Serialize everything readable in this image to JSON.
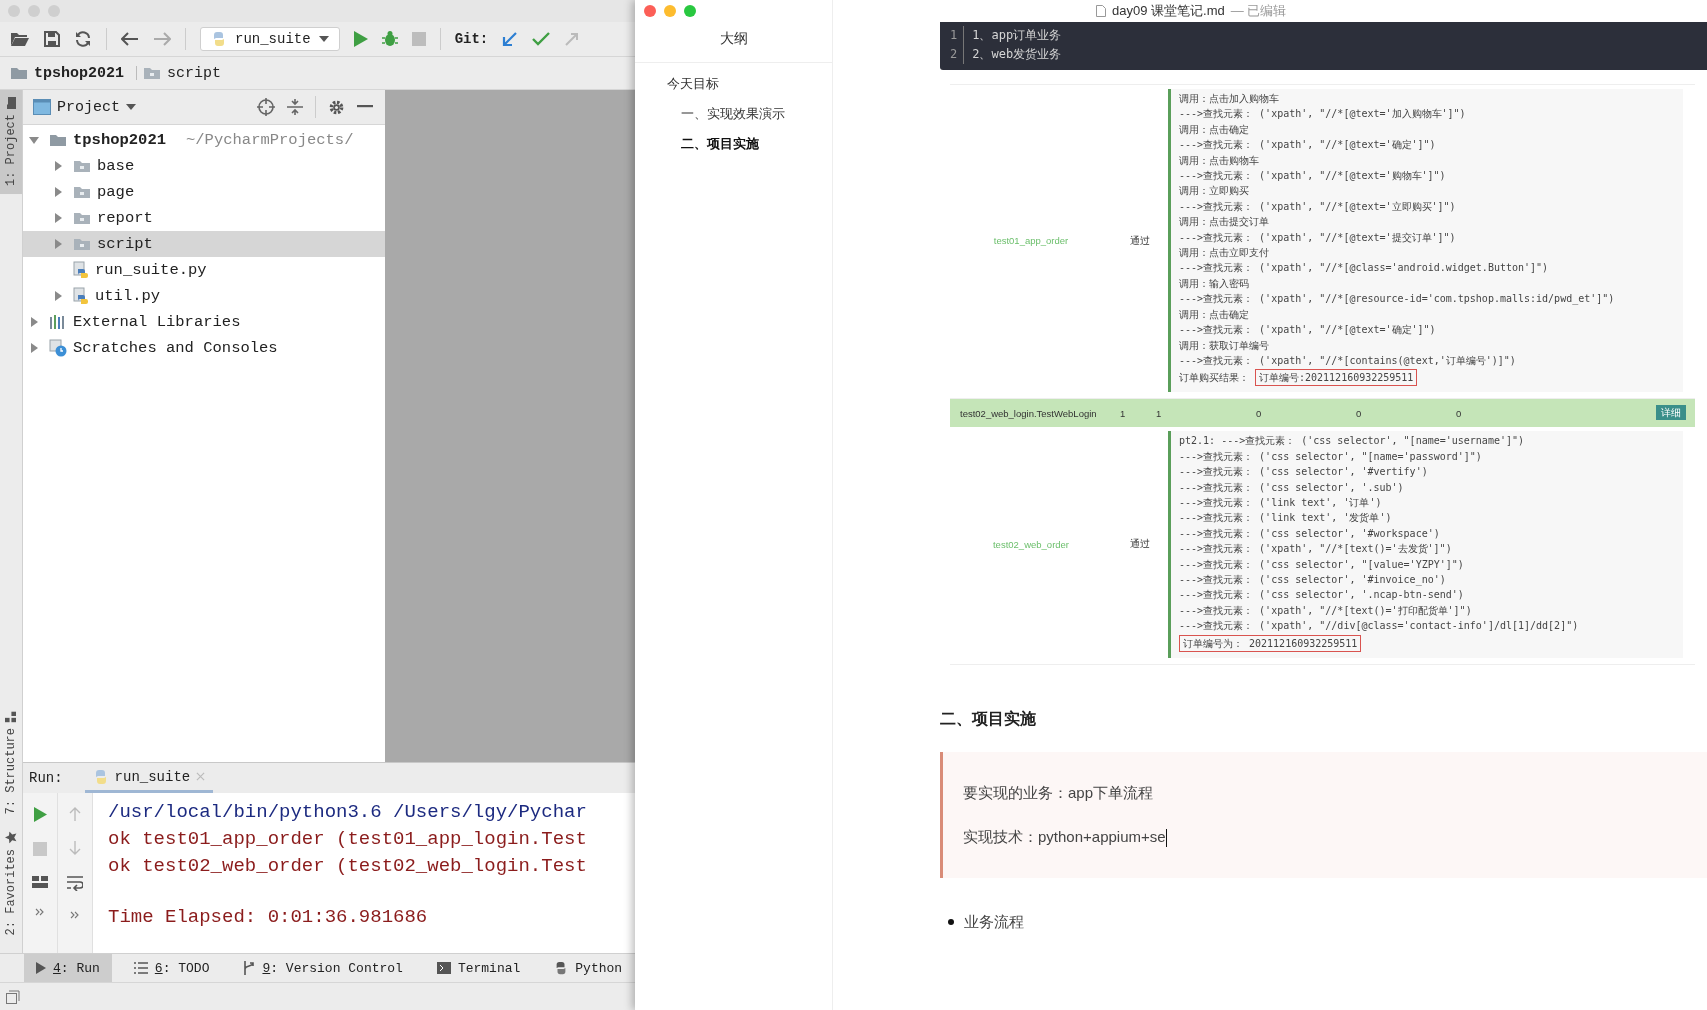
{
  "ide": {
    "toolbar": {
      "run_config": "run_suite",
      "git_label": "Git:"
    },
    "breadcrumbs": [
      {
        "label": "tpshop2021",
        "kind": "project"
      },
      {
        "label": "script",
        "kind": "folder"
      }
    ],
    "side_tabs": [
      {
        "label": "1: Project",
        "selected": true,
        "kind": "project"
      },
      {
        "label": "7: Structure",
        "selected": false,
        "kind": "structure"
      },
      {
        "label": "2: Favorites",
        "selected": false,
        "kind": "favorites"
      }
    ],
    "project_panel": {
      "title": "Project",
      "tree": [
        {
          "label": "tpshop2021",
          "path": "~/PycharmProjects/",
          "kind": "project",
          "expanded": true,
          "selected": false,
          "children": [
            {
              "label": "base",
              "kind": "folder",
              "expanded": false,
              "selected": false
            },
            {
              "label": "page",
              "kind": "folder",
              "expanded": false,
              "selected": false
            },
            {
              "label": "report",
              "kind": "folder",
              "expanded": false,
              "selected": false
            },
            {
              "label": "script",
              "kind": "folder",
              "expanded": false,
              "selected": true
            },
            {
              "label": "run_suite.py",
              "kind": "python",
              "selected": false
            },
            {
              "label": "util.py",
              "kind": "python",
              "expanded": false,
              "selected": false
            }
          ]
        },
        {
          "label": "External Libraries",
          "kind": "libraries",
          "expanded": false,
          "selected": false
        },
        {
          "label": "Scratches and Consoles",
          "kind": "scratches",
          "expanded": false,
          "selected": false
        }
      ]
    },
    "run_panel": {
      "label": "Run:",
      "tabs": [
        {
          "label": "run_suite",
          "selected": true
        }
      ],
      "output": [
        {
          "kind": "command",
          "text": "/usr/local/bin/python3.6 /Users/lgy/Pychar"
        },
        {
          "kind": "stdout",
          "text": "ok test01_app_order (test01_app_login.Test"
        },
        {
          "kind": "stdout",
          "text": "ok test02_web_order (test02_web_login.Test"
        },
        {
          "kind": "summary",
          "text": "Time Elapsed: 0:01:36.981686"
        }
      ]
    },
    "tool_tabs": [
      {
        "label": "4: Run",
        "kind": "run",
        "selected": true,
        "mnemonic": true
      },
      {
        "label": "6: TODO",
        "kind": "todo",
        "selected": false,
        "mnemonic": true
      },
      {
        "label": "9: Version Control",
        "kind": "vcs",
        "selected": false,
        "mnemonic": true
      },
      {
        "label": "Terminal",
        "kind": "terminal",
        "selected": false,
        "mnemonic": false
      },
      {
        "label": "Python",
        "kind": "python",
        "selected": false,
        "mnemonic": false
      }
    ]
  },
  "typora": {
    "title": "day09 课堂笔记.md",
    "title_status": "— 已编辑",
    "outline": {
      "title": "大纲",
      "items": [
        {
          "label": "今天目标",
          "selected": false,
          "children": [
            {
              "label": "一、实现效果演示",
              "selected": false
            },
            {
              "label": "二、项目实施",
              "selected": true
            }
          ]
        }
      ]
    },
    "document": {
      "code_block": {
        "lines": [
          {
            "number": "1",
            "text": "1、app订单业务"
          },
          {
            "number": "2",
            "text": "2、web发货业务"
          }
        ]
      },
      "report": {
        "rows": [
          {
            "kind": "case",
            "name": "test01_app_order",
            "status": "通过",
            "log": [
              "调用：点击加入购物车",
              "--->查找元素：  ('xpath', \"//*[@text='加入购物车']\")",
              "调用：点击确定",
              "--->查找元素：  ('xpath', \"//*[@text='确定']\")",
              "调用：点击购物车",
              "--->查找元素：  ('xpath', \"//*[@text='购物车']\")",
              "调用：立即购买",
              "--->查找元素：  ('xpath', \"//*[@text='立即购买']\")",
              "调用：点击提交订单",
              "--->查找元素：  ('xpath', \"//*[@text='提交订单']\")",
              "调用：点击立即支付",
              "--->查找元素：  ('xpath', \"//*[@class='android.widget.Button']\")",
              "调用：输入密码",
              "--->查找元素：  ('xpath', \"//*[@resource-id='com.tpshop.malls:id/pwd_et']\")",
              "调用：点击确定",
              "--->查找元素：  ('xpath', \"//*[@text='确定']\")",
              "调用：获取订单编号",
              "--->查找元素：  ('xpath', \"//*[contains(@text,'订单编号')]\")"
            ],
            "result_label": "订单购买结果：",
            "result": "订单编号:202112160932259511"
          },
          {
            "kind": "summary",
            "cells": [
              "test02_web_login.TestWebLogin",
              "1",
              "1",
              "0",
              "0",
              "0"
            ],
            "button": "详细"
          },
          {
            "kind": "case",
            "name": "test02_web_order",
            "status": "通过",
            "log": [
              "pt2.1: --->查找元素：  ('css selector', \"[name='username']\")",
              "--->查找元素：  ('css selector', \"[name='password']\")",
              "--->查找元素：  ('css selector', '#vertify')",
              "--->查找元素：  ('css selector', '.sub')",
              "--->查找元素：  ('link text', '订单')",
              "--->查找元素：  ('link text', '发货单')",
              "--->查找元素：  ('css selector', '#workspace')",
              "--->查找元素：  ('xpath', \"//*[text()='去发货']\")",
              "--->查找元素：  ('css selector', \"[value='YZPY']\")",
              "--->查找元素：  ('css selector', '#invoice_no')",
              "--->查找元素：  ('css selector', '.ncap-btn-send')",
              "--->查找元素：  ('xpath', \"//*[text()='打印配货单']\")",
              "--->查找元素：  ('xpath', \"//div[@class='contact-info']/dl[1]/dd[2]\")"
            ],
            "result": "订单编号为：  202112160932259511"
          }
        ]
      },
      "heading": "二、项目实施",
      "blockquote": [
        "要实现的业务：app下单流程",
        "实现技术：python+appium+se"
      ],
      "bullets": [
        "业务流程"
      ]
    }
  }
}
